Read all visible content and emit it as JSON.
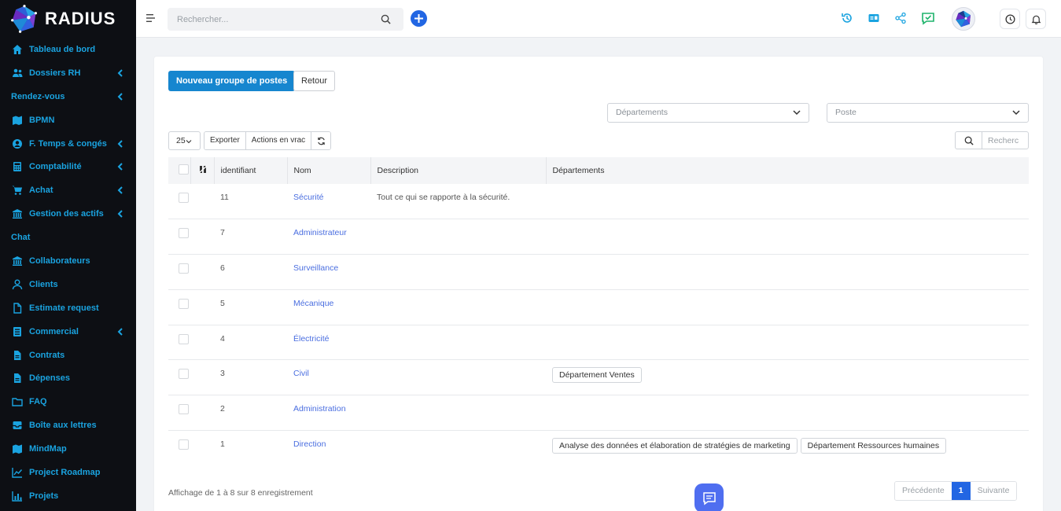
{
  "app": {
    "name": "RADIUS"
  },
  "sidebar": {
    "items": [
      {
        "label": "Tableau de bord",
        "icon": "home-icon",
        "chevron": false
      },
      {
        "label": "Dossiers RH",
        "icon": "users-icon",
        "chevron": true
      },
      {
        "label": "Rendez-vous",
        "icon": "",
        "chevron": true
      },
      {
        "label": "BPMN",
        "icon": "map-icon",
        "chevron": false
      },
      {
        "label": "F. Temps & congés",
        "icon": "user-circle-icon",
        "chevron": true
      },
      {
        "label": "Comptabilité",
        "icon": "calculator-icon",
        "chevron": true
      },
      {
        "label": "Achat",
        "icon": "cart-icon",
        "chevron": true
      },
      {
        "label": "Gestion des actifs",
        "icon": "bank-icon",
        "chevron": true
      },
      {
        "label": "Chat",
        "icon": "",
        "chevron": false
      },
      {
        "label": "Collaborateurs",
        "icon": "bank-icon",
        "chevron": false
      },
      {
        "label": "Clients",
        "icon": "user-icon",
        "chevron": false
      },
      {
        "label": "Estimate request",
        "icon": "file-icon",
        "chevron": false
      },
      {
        "label": "Commercial",
        "icon": "list-icon",
        "chevron": true
      },
      {
        "label": "Contrats",
        "icon": "document-icon",
        "chevron": false
      },
      {
        "label": "Dépenses",
        "icon": "document-icon",
        "chevron": false
      },
      {
        "label": "FAQ",
        "icon": "folder-icon",
        "chevron": false
      },
      {
        "label": "Boîte aux lettres",
        "icon": "mailbox-icon",
        "chevron": false
      },
      {
        "label": "MindMap",
        "icon": "map-icon",
        "chevron": false
      },
      {
        "label": "Project Roadmap",
        "icon": "line-chart-icon",
        "chevron": false
      },
      {
        "label": "Projets",
        "icon": "chart-icon",
        "chevron": false
      }
    ]
  },
  "header": {
    "search_placeholder": "Rechercher..."
  },
  "toolbar": {
    "new_group_label": "Nouveau groupe de postes",
    "back_label": "Retour"
  },
  "filters": {
    "departments_placeholder": "Départements",
    "post_placeholder": "Poste"
  },
  "table_controls": {
    "page_size": "25",
    "export_label": "Exporter",
    "bulk_actions_label": "Actions en vrac",
    "search_placeholder": "Recherc"
  },
  "table": {
    "columns": [
      "identifiant",
      "Nom",
      "Description",
      "Départements"
    ],
    "rows": [
      {
        "id": "11",
        "name": "Sécurité",
        "description": "Tout ce qui se rapporte à la sécurité.",
        "departments": []
      },
      {
        "id": "7",
        "name": "Administrateur",
        "description": "",
        "departments": []
      },
      {
        "id": "6",
        "name": "Surveillance",
        "description": "",
        "departments": []
      },
      {
        "id": "5",
        "name": "Mécanique",
        "description": "",
        "departments": []
      },
      {
        "id": "4",
        "name": "Électricité",
        "description": "",
        "departments": []
      },
      {
        "id": "3",
        "name": "Civil",
        "description": "",
        "departments": [
          "Département Ventes"
        ]
      },
      {
        "id": "2",
        "name": "Administration",
        "description": "",
        "departments": []
      },
      {
        "id": "1",
        "name": "Direction",
        "description": "",
        "departments": [
          "Analyse des données et élaboration de stratégies de marketing",
          "Département Ressources humaines"
        ]
      }
    ]
  },
  "footer": {
    "info": "Affichage de 1 à 8 sur 8 enregistrement",
    "prev_label": "Précédente",
    "current_page": "1",
    "next_label": "Suivante"
  },
  "colors": {
    "sidebar_bg": "#0d0f14",
    "sidebar_text": "#1aa3e0",
    "primary": "#1686cf",
    "accent": "#2266e3",
    "link": "#4a6ee0"
  }
}
